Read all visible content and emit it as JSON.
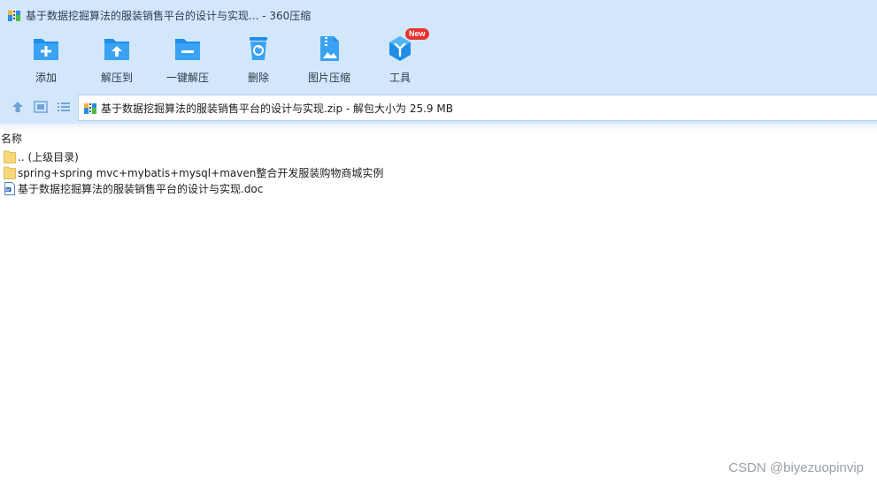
{
  "window": {
    "title": "基于数据挖掘算法的服装销售平台的设计与实现... - 360压缩"
  },
  "toolbar": {
    "items": [
      {
        "label": "添加",
        "icon": "add-icon"
      },
      {
        "label": "解压到",
        "icon": "extract-to-icon"
      },
      {
        "label": "一键解压",
        "icon": "one-click-extract-icon"
      },
      {
        "label": "删除",
        "icon": "delete-icon"
      },
      {
        "label": "图片压缩",
        "icon": "image-compress-icon"
      },
      {
        "label": "工具",
        "icon": "tools-icon",
        "badge": "New"
      }
    ]
  },
  "address": {
    "text": "基于数据挖掘算法的服装销售平台的设计与实现.zip - 解包大小为 25.9 MB"
  },
  "list": {
    "column_name": "名称",
    "rows": [
      {
        "name": ".. (上级目录)",
        "type": "folder"
      },
      {
        "name": "spring+spring mvc+mybatis+mysql+maven整合开发服装购物商城实例",
        "type": "folder"
      },
      {
        "name": "基于数据挖掘算法的服装销售平台的设计与实现.doc",
        "type": "doc"
      }
    ]
  },
  "watermark": "CSDN @biyezuopinvip",
  "colors": {
    "chrome_bg": "#d3e7fb",
    "icon_blue": "#1e8ee8",
    "badge_red": "#e8322f",
    "folder_yellow": "#f6d77a"
  }
}
